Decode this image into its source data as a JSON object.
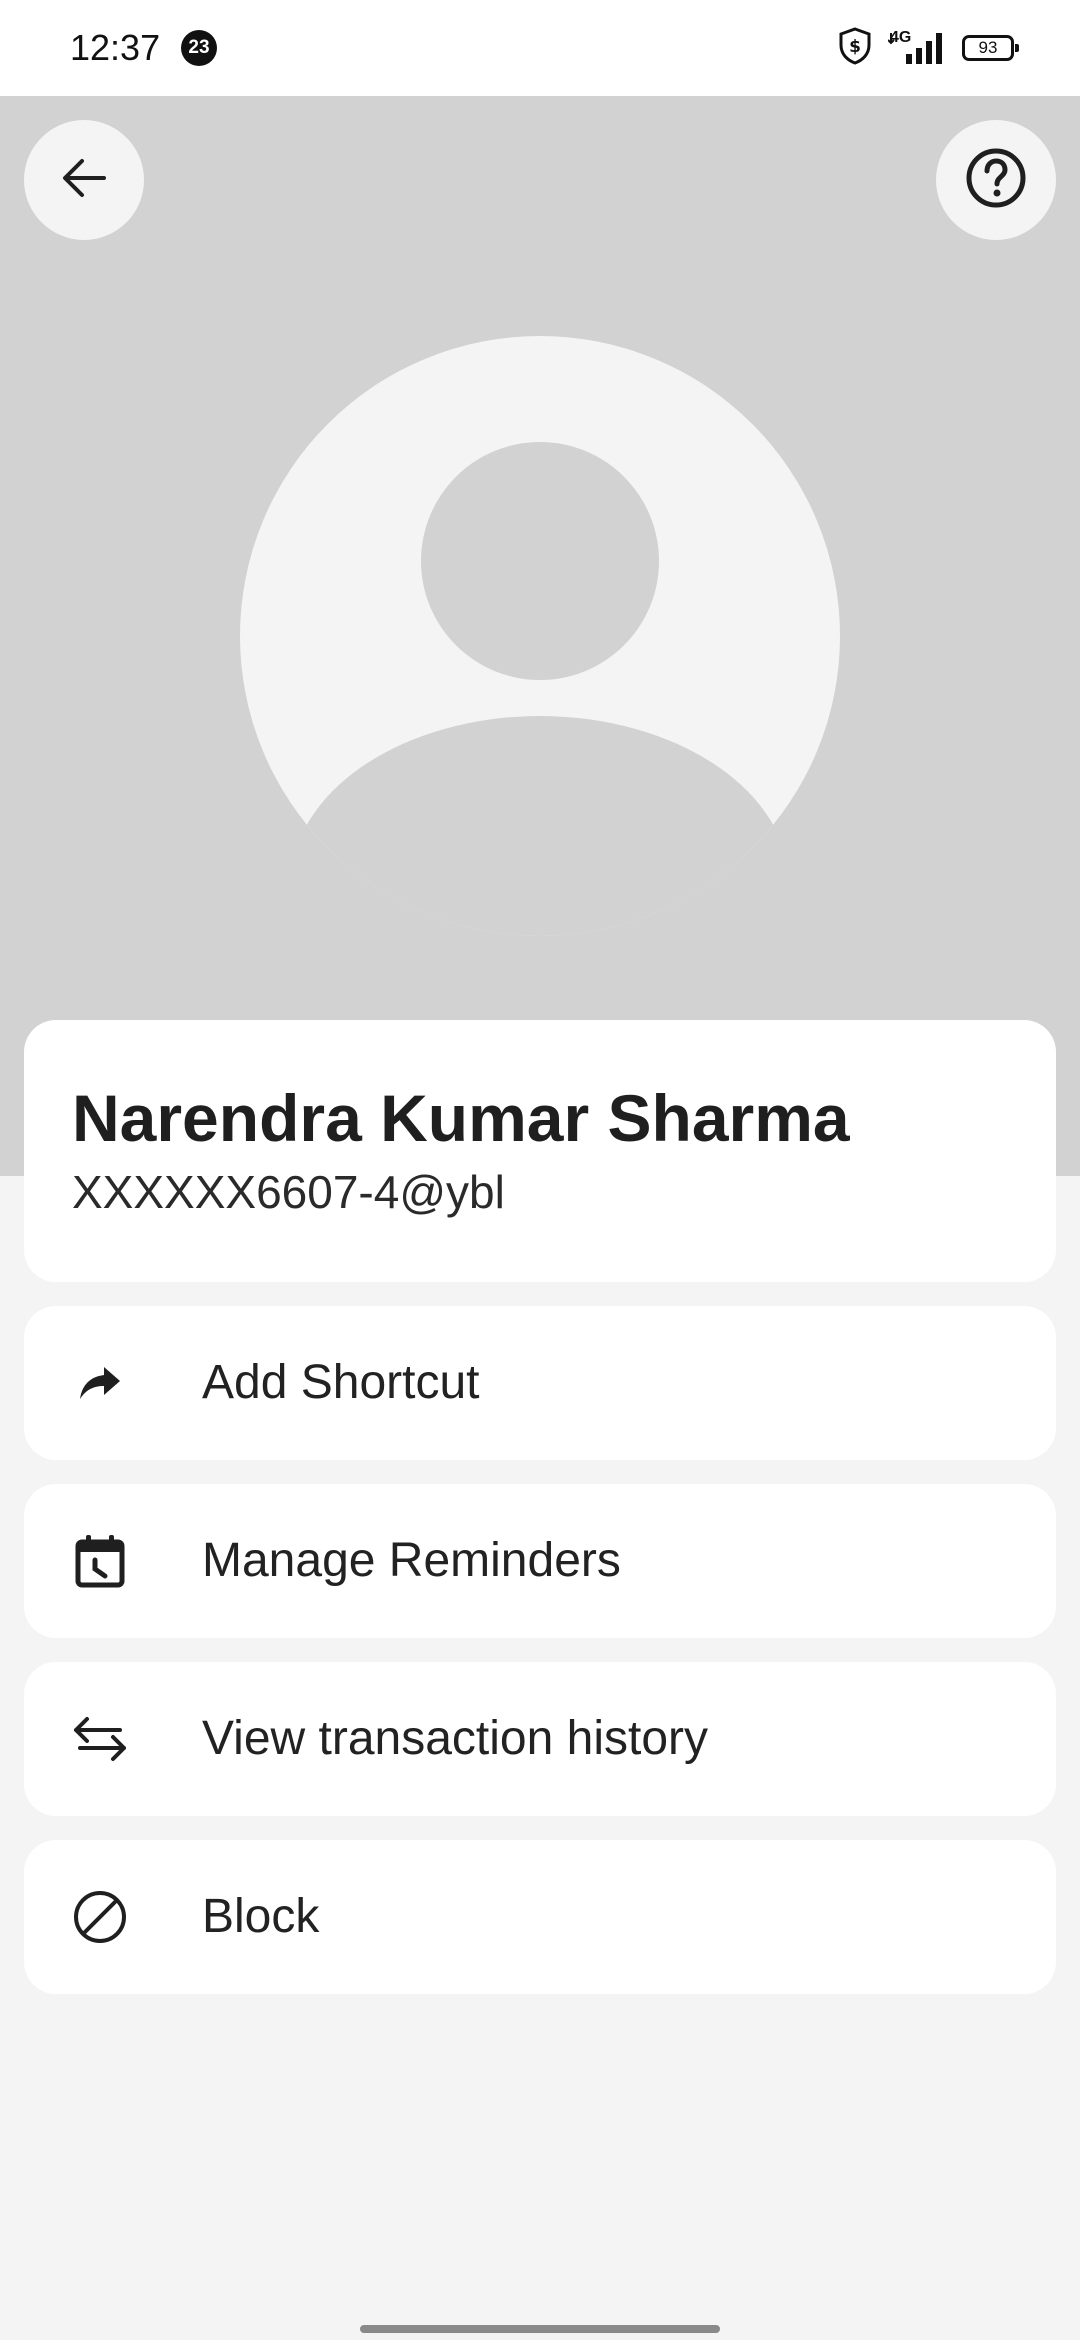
{
  "status_bar": {
    "time": "12:37",
    "notification_count": "23",
    "network": "4G",
    "battery": "93"
  },
  "header": {
    "back_icon": "arrow-left-icon",
    "help_icon": "question-circle-icon",
    "avatar_icon": "default-person-avatar"
  },
  "contact": {
    "name": "Narendra Kumar Sharma",
    "upi_id": "XXXXXX6607-4@ybl"
  },
  "actions": [
    {
      "label": "Add Shortcut",
      "icon": "share-arrow-icon"
    },
    {
      "label": "Manage Reminders",
      "icon": "calendar-clock-icon"
    },
    {
      "label": "View transaction history",
      "icon": "transfer-arrows-icon"
    },
    {
      "label": "Block",
      "icon": "block-icon"
    }
  ],
  "colors": {
    "header_background": "#d2d2d2",
    "page_background": "#f4f4f4",
    "card_background": "#ffffff",
    "text_primary": "#1f1f1f"
  }
}
